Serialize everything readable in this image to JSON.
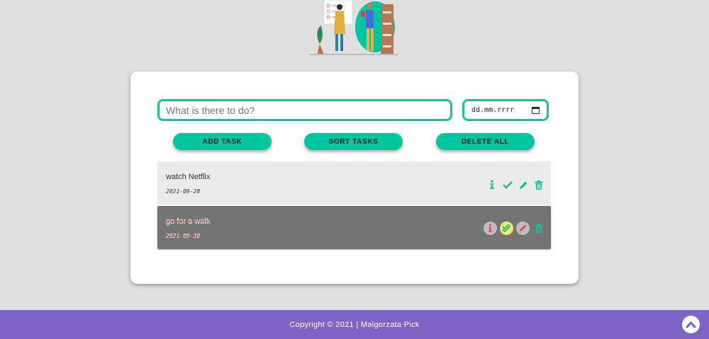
{
  "form": {
    "task_placeholder": "What is there to do?",
    "date_placeholder": "dd.mm.rrrr"
  },
  "buttons": {
    "add": "ADD TASK",
    "sort": "SORT TASKS",
    "delete_all": "DELETE ALL"
  },
  "tasks": [
    {
      "title": "watch Netflix",
      "date": "2021-09-28",
      "done": false,
      "icons": [
        "info-icon",
        "check-icon",
        "pencil-icon",
        "trash-icon"
      ]
    },
    {
      "title": "go for a walk",
      "date": "2021-09-30",
      "done": true,
      "icons": [
        "info-icon",
        "double-check-icon",
        "pencil-icon",
        "trash-icon"
      ]
    }
  ],
  "footer": {
    "copyright": "Copyright © 2021 | Malgorzata Pick"
  },
  "colors": {
    "accent": "#00c6a0",
    "input_border": "#1fbf9a",
    "footer": "#7e64c4",
    "background": "#e0e0e0",
    "done_task": "#747474",
    "pending_task": "#ebebeb"
  }
}
